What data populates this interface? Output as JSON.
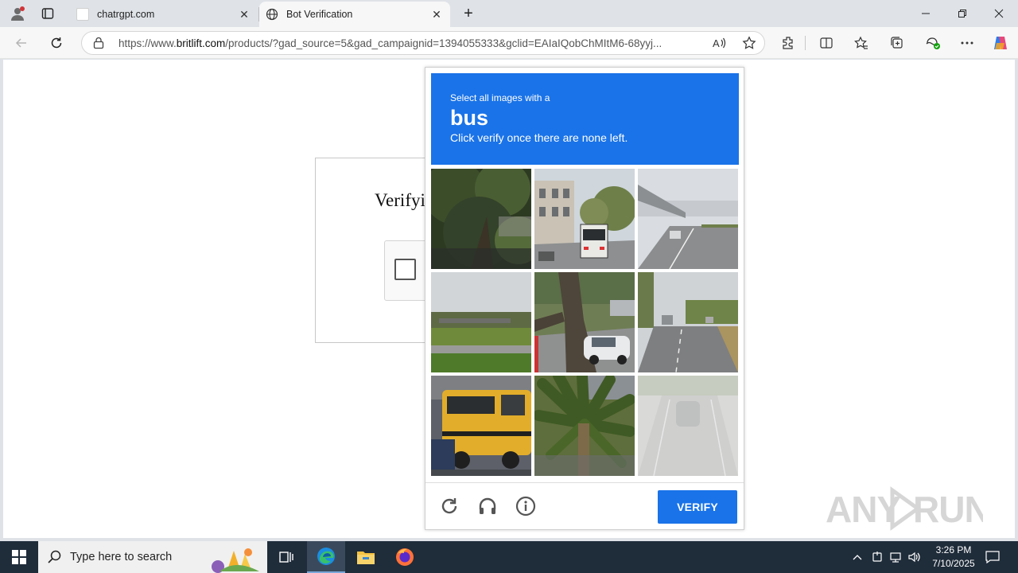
{
  "browser": {
    "tabs": [
      {
        "title": "chatrgpt.com",
        "active": false
      },
      {
        "title": "Bot Verification",
        "active": true
      }
    ],
    "url_prefix": "https://www.",
    "url_domain": "britlift.com",
    "url_rest": "/products/?gad_source=5&gad_campaignid=1394055333&gclid=EAIaIQobChMItM6-68yyj..."
  },
  "page": {
    "verify_title": "Verifyi"
  },
  "captcha": {
    "instruction_top": "Select all images with a",
    "target": "bus",
    "instruction_bottom": "Click verify once there are none left.",
    "verify_label": "VERIFY",
    "header_color": "#1a73e8",
    "tiles": [
      "trees",
      "bus-street",
      "highway",
      "overpass",
      "tree-car",
      "road",
      "school-bus",
      "palm",
      "faded-road"
    ]
  },
  "watermark": "ANY.RUN",
  "taskbar": {
    "search_placeholder": "Type here to search",
    "time": "3:26 PM",
    "date": "7/10/2025"
  }
}
